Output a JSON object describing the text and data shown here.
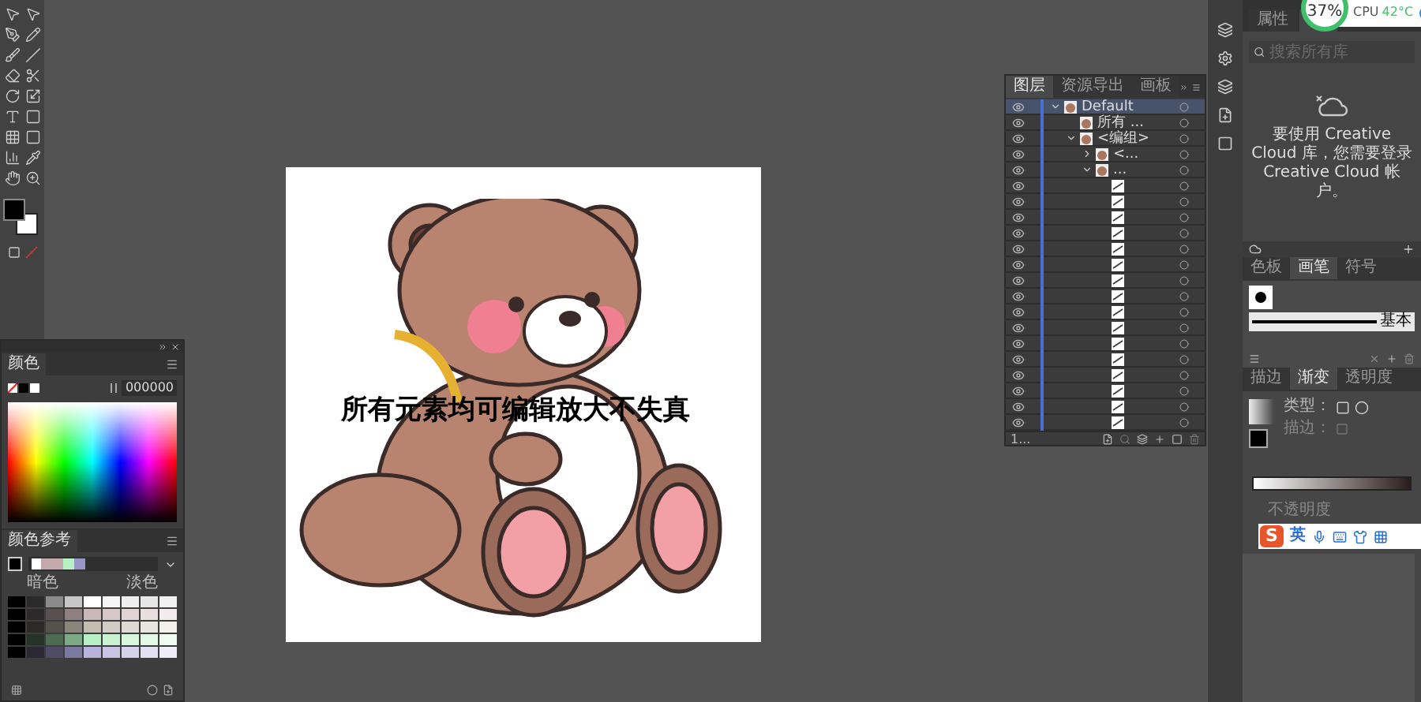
{
  "color_panel": {
    "title": "颜色",
    "hex": "000000"
  },
  "color_guide": {
    "title": "颜色参考",
    "left_label": "暗色",
    "right_label": "淡色"
  },
  "canvas": {
    "caption": "所有元素均可编辑放大不失真"
  },
  "layers_panel": {
    "tabs": [
      {
        "label": "图层",
        "selected": true
      },
      {
        "label": "资源导出",
        "selected": false
      },
      {
        "label": "画板",
        "selected": false
      }
    ],
    "layers": [
      {
        "kind": "group",
        "name": "Default",
        "expanded": true,
        "selected": true,
        "children": [
          {
            "kind": "group",
            "name": "所有 ...",
            "selected": false
          },
          {
            "kind": "group",
            "name": "<编组>",
            "expanded": true,
            "selected": false,
            "children": [
              {
                "kind": "group",
                "name": "<...",
                "expanded": false,
                "selected": false
              },
              {
                "kind": "group",
                "name": "...",
                "expanded": true,
                "selected": false,
                "children": [
                  {
                    "kind": "path",
                    "selected": false
                  },
                  {
                    "kind": "path",
                    "selected": false
                  },
                  {
                    "kind": "path",
                    "selected": false
                  },
                  {
                    "kind": "path",
                    "selected": false
                  },
                  {
                    "kind": "path",
                    "selected": false
                  },
                  {
                    "kind": "path",
                    "selected": false
                  },
                  {
                    "kind": "path",
                    "selected": false
                  },
                  {
                    "kind": "path",
                    "selected": false
                  },
                  {
                    "kind": "path",
                    "selected": false
                  },
                  {
                    "kind": "path",
                    "selected": false
                  },
                  {
                    "kind": "path",
                    "selected": false
                  },
                  {
                    "kind": "path",
                    "selected": false
                  },
                  {
                    "kind": "path",
                    "selected": false
                  },
                  {
                    "kind": "path",
                    "selected": false
                  },
                  {
                    "kind": "path",
                    "selected": false
                  },
                  {
                    "kind": "path",
                    "selected": false
                  }
                ]
              }
            ]
          }
        ]
      }
    ],
    "footer": "1..."
  },
  "status_widget": {
    "percent": "37%",
    "cpu_label": "CPU",
    "cpu_temp": "42°C"
  },
  "properties_panel": {
    "tabs": [
      {
        "label": "属性",
        "selected": false
      }
    ]
  },
  "libraries": {
    "search_placeholder": "搜索所有库",
    "message": "要使用 Creative Cloud 库，您需要登录 Creative Cloud 帐户。"
  },
  "brushes_panel": {
    "tabs": [
      {
        "label": "色板",
        "selected": false
      },
      {
        "label": "画笔",
        "selected": true
      },
      {
        "label": "符号",
        "selected": false
      }
    ],
    "brush_label": "基本"
  },
  "gradient_panel": {
    "tabs": [
      {
        "label": "描边",
        "selected": false
      },
      {
        "label": "渐变",
        "selected": true
      },
      {
        "label": "透明度",
        "selected": false
      }
    ],
    "type_label": "类型：",
    "stroke_label": "描边：",
    "opacity_label": "不透明度"
  },
  "ime_bar": {
    "logo": "S",
    "mode": "英"
  }
}
